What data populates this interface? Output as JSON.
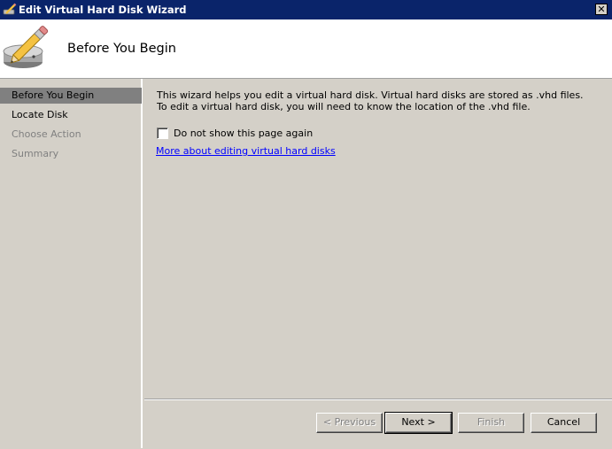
{
  "window": {
    "title": "Edit Virtual Hard Disk Wizard",
    "close_glyph": "✕"
  },
  "header": {
    "title": "Before You Begin"
  },
  "sidebar": {
    "items": [
      {
        "label": "Before You Begin",
        "state": "active"
      },
      {
        "label": "Locate Disk",
        "state": "enabled"
      },
      {
        "label": "Choose Action",
        "state": "disabled"
      },
      {
        "label": "Summary",
        "state": "disabled"
      }
    ]
  },
  "content": {
    "description": "This wizard helps you edit a virtual hard disk. Virtual hard disks are stored as .vhd files. To edit a virtual hard disk, you will need to know the location of the .vhd file.",
    "checkbox_label": "Do not show this page again",
    "checkbox_checked": false,
    "link_text": "More about editing virtual hard disks"
  },
  "buttons": {
    "previous": "< Previous",
    "next": "Next >",
    "finish": "Finish",
    "cancel": "Cancel"
  },
  "colors": {
    "titlebar": "#0a246a",
    "active_nav": "#808080",
    "link": "#0000ff",
    "face": "#d4d0c8"
  }
}
